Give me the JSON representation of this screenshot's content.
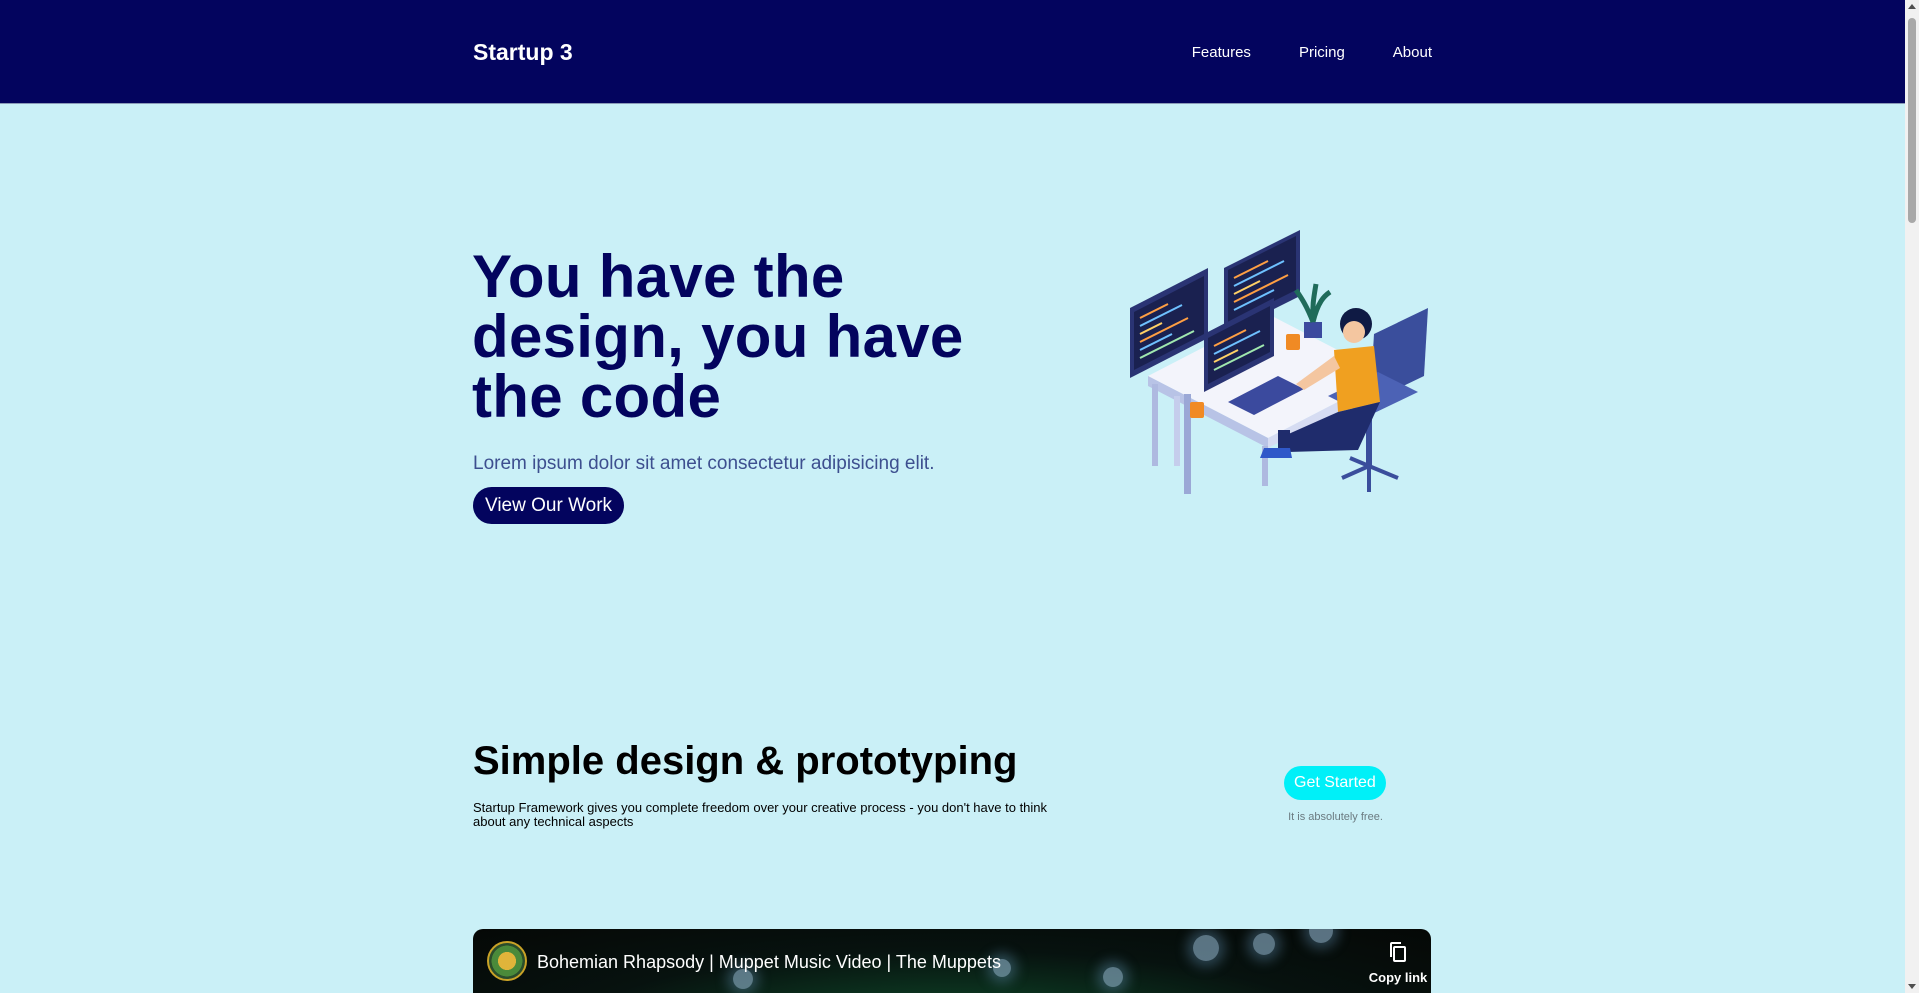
{
  "header": {
    "brand": "Startup 3",
    "nav": [
      {
        "label": "Features"
      },
      {
        "label": "Pricing"
      },
      {
        "label": "About"
      }
    ]
  },
  "hero": {
    "title": "You have the design, you have the code",
    "subtitle": "Lorem ipsum dolor sit amet consectetur adipisicing elit.",
    "button_label": "View Our Work",
    "illustration": "developer-at-desk-illustration"
  },
  "feature": {
    "title": "Simple design & prototyping",
    "text": "Startup Framework gives you complete freedom over your creative process - you don't have to think about any technical aspects",
    "cta_label": "Get Started",
    "cta_note": "It is absolutely free."
  },
  "video": {
    "title": "Bohemian Rhapsody | Muppet Music Video | The Muppets",
    "copy_link_label": "Copy link",
    "copy_icon": "copy-icon"
  },
  "colors": {
    "navy": "#03045e",
    "background": "#caf0f7",
    "cyan": "#00f0f8",
    "subtitle": "#3d4f8f"
  }
}
